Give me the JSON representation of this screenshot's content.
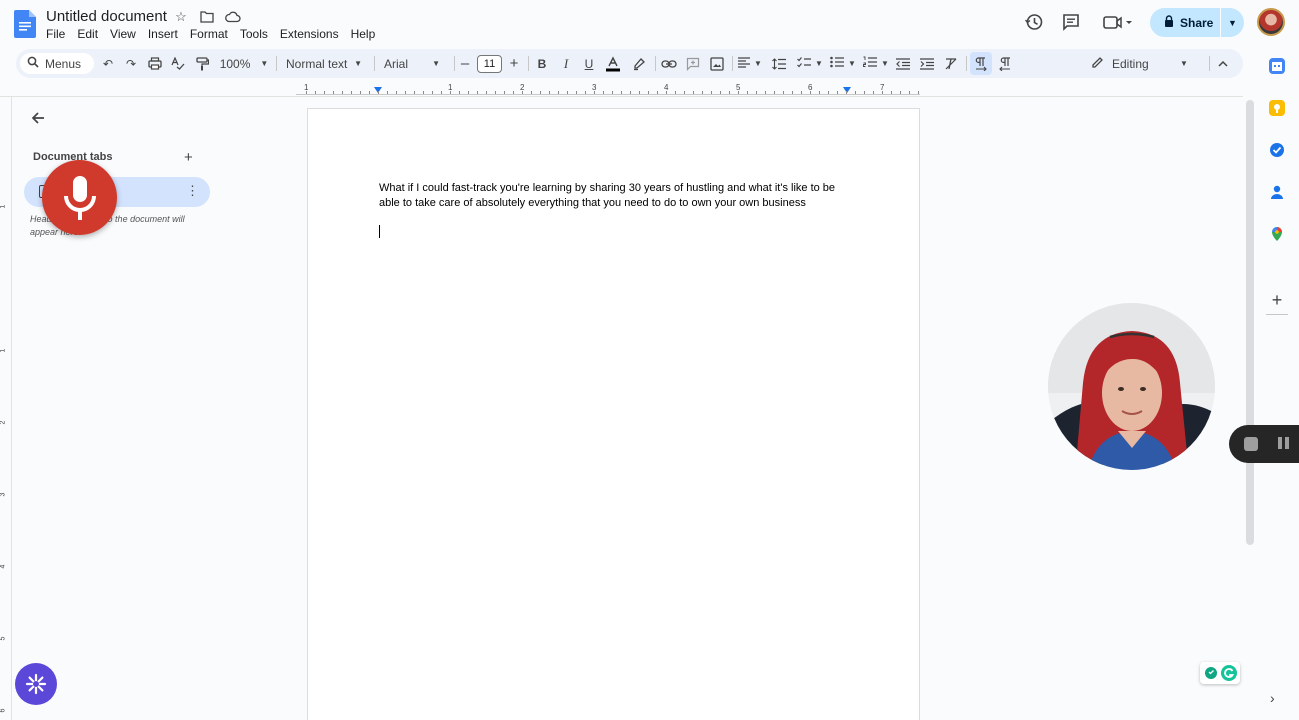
{
  "header": {
    "doc_title": "Untitled document",
    "menus": [
      "File",
      "Edit",
      "View",
      "Insert",
      "Format",
      "Tools",
      "Extensions",
      "Help"
    ],
    "share_label": "Share"
  },
  "toolbar": {
    "search_label": "Menus",
    "zoom": "100%",
    "style": "Normal text",
    "font": "Arial",
    "font_size": "11",
    "mode": "Editing"
  },
  "ruler": {
    "numbers": [
      "1",
      "1",
      "2",
      "3",
      "4",
      "5",
      "6",
      "7"
    ],
    "vnumbers": [
      "1",
      "1",
      "2",
      "3",
      "4",
      "5",
      "6"
    ]
  },
  "sidebar": {
    "title": "Document tabs",
    "hint": "Headings you add to the document will appear here."
  },
  "document": {
    "body": "What if I could fast-track you're learning by sharing 30 years of hustling and what it's like to be able to take care of absolutely everything that you need to do to own your own business"
  },
  "colors": {
    "accent": "#1a73e8",
    "share_bg": "#c2e7ff",
    "mic": "#cf3a2c",
    "ai_fab": "#5b48d9"
  }
}
